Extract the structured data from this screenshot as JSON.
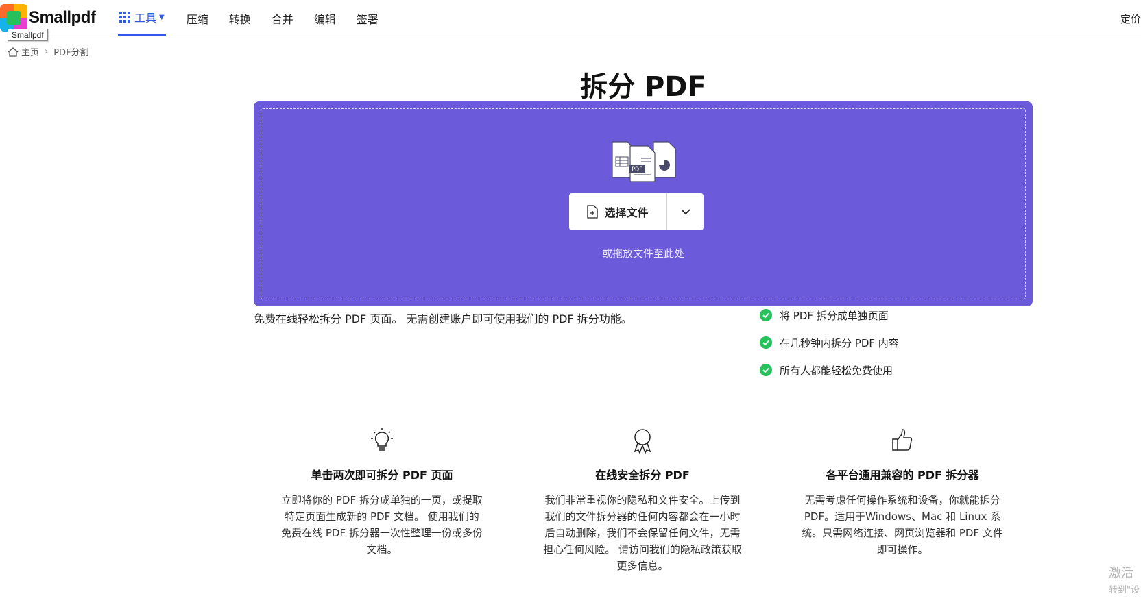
{
  "header": {
    "logo_text": "Smallpdf",
    "tooltip": "Smallpdf",
    "tools_label": "工具",
    "nav_items": [
      "压缩",
      "转换",
      "合并",
      "编辑",
      "签署"
    ],
    "pricing_label": "定价"
  },
  "breadcrumb": {
    "home": "主页",
    "separator": "›",
    "current": "PDF分割"
  },
  "title": "拆分 PDF",
  "dropzone": {
    "select_label": "选择文件",
    "hint": "或拖放文件至此处",
    "file_badge": "PDF",
    "accent": "#6b5ad9"
  },
  "description": "免费在线轻松拆分 PDF 页面。 无需创建账户即可使用我们的 PDF 拆分功能。",
  "features": [
    "将 PDF 拆分成单独页面",
    "在几秒钟内拆分 PDF 内容",
    "所有人都能轻松免费使用"
  ],
  "columns": [
    {
      "icon": "lightbulb-icon",
      "title": "单击两次即可拆分 PDF 页面",
      "text": "立即将你的 PDF 拆分成单独的一页，或提取特定页面生成新的 PDF 文档。 使用我们的免费在线 PDF 拆分器一次性整理一份或多份文档。"
    },
    {
      "icon": "award-icon",
      "title": "在线安全拆分 PDF",
      "text": "我们非常重视你的隐私和文件安全。上传到我们的文件拆分器的任何内容都会在一小时后自动删除，我们不会保留任何文件，无需担心任何风险。 请访问我们的隐私政策获取更多信息。"
    },
    {
      "icon": "thumbs-up-icon",
      "title": "各平台通用兼容的 PDF 拆分器",
      "text": "无需考虑任何操作系统和设备，你就能拆分 PDF。适用于Windows、Mac 和 Linux 系统。只需网络连接、网页浏览器和 PDF 文件即可操作。"
    }
  ],
  "watermark": {
    "line1": "激活",
    "line2": "转到\"设"
  },
  "colors": {
    "brand_blue": "#2f5ce6",
    "check_green": "#27c15b"
  }
}
